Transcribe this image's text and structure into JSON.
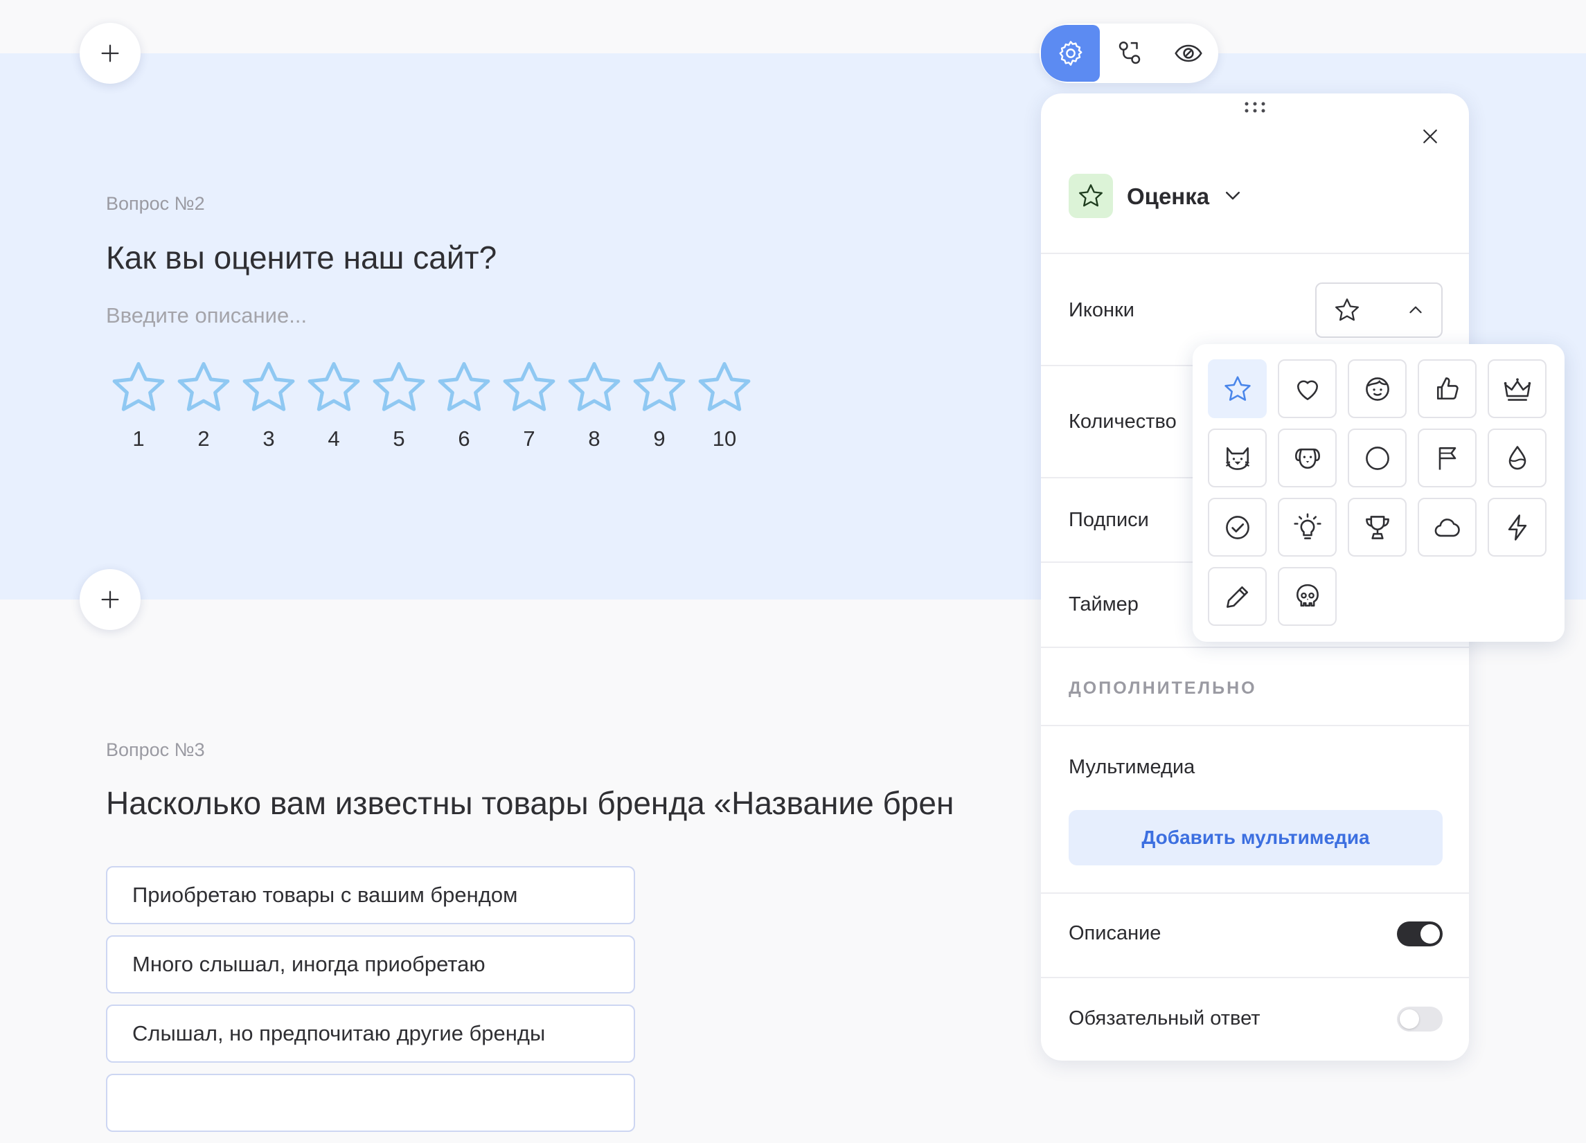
{
  "question2": {
    "label": "Вопрос №2",
    "title": "Как вы оцените наш сайт?",
    "description_placeholder": "Введите описание...",
    "star_labels": [
      "1",
      "2",
      "3",
      "4",
      "5",
      "6",
      "7",
      "8",
      "9",
      "10"
    ]
  },
  "question3": {
    "label": "Вопрос №3",
    "title": "Насколько вам известны товары бренда «Название брен",
    "answers": [
      "Приобретаю товары с вашим брендом",
      "Много слышал, иногда приобретаю",
      "Слышал, но предпочитаю другие бренды"
    ]
  },
  "toolbar": {
    "icons": [
      "gear-icon",
      "logic-branch-icon",
      "eye-preview-icon"
    ],
    "active": "gear-icon"
  },
  "panel": {
    "type_label": "Оценка",
    "type_icon": "star-icon",
    "rows": {
      "icons": "Иконки",
      "count": "Количество",
      "labels": "Подписи",
      "timer": "Таймер"
    },
    "section_extra": "ДОПОЛНИТЕЛЬНО",
    "multimedia_label": "Мультимедиа",
    "multimedia_button": "Добавить мультимедиа",
    "description_label": "Описание",
    "description_on": true,
    "required_label": "Обязательный ответ",
    "required_on": false
  },
  "icon_picker": {
    "options": [
      "star",
      "heart",
      "face",
      "thumbs-up",
      "crown",
      "cat",
      "dog",
      "circle",
      "flag",
      "drop",
      "check-circle",
      "lightbulb",
      "trophy",
      "cloud",
      "lightning",
      "pencil",
      "skull"
    ],
    "selected": "star"
  },
  "colors": {
    "band": "#e8f0fe",
    "accent": "#5c8bf2",
    "star_outline": "#8fc8f2",
    "link": "#3c6fe0",
    "type_badge": "#dcf3d7"
  }
}
